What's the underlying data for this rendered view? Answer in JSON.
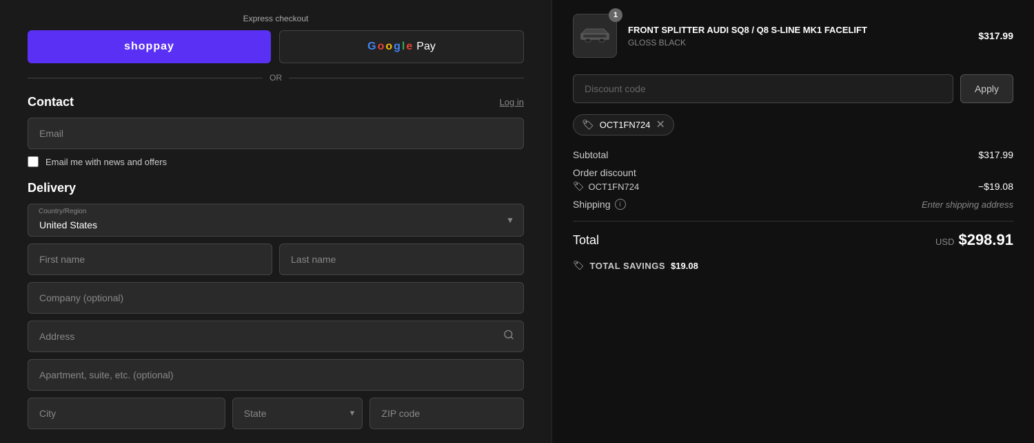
{
  "left": {
    "express_checkout_label": "Express checkout",
    "shop_pay_label": "shop pay",
    "google_pay_label": "Pay",
    "or_label": "OR",
    "contact": {
      "title": "Contact",
      "log_in_label": "Log in",
      "email_placeholder": "Email",
      "newsletter_label": "Email me with news and offers"
    },
    "delivery": {
      "title": "Delivery",
      "country_label": "Country/Region",
      "country_value": "United States",
      "first_name_placeholder": "First name",
      "last_name_placeholder": "Last name",
      "company_placeholder": "Company (optional)",
      "address_placeholder": "Address",
      "apartment_placeholder": "Apartment, suite, etc. (optional)",
      "city_placeholder": "City",
      "state_placeholder": "State",
      "zip_placeholder": "ZIP code"
    }
  },
  "right": {
    "product": {
      "name": "FRONT SPLITTER AUDI SQ8 / Q8 S-LINE MK1 FACELIFT",
      "variant": "GLOSS BLACK",
      "price": "$317.99",
      "badge": "1"
    },
    "discount": {
      "input_placeholder": "Discount code",
      "apply_label": "Apply"
    },
    "applied_code": {
      "code": "OCT1FN724",
      "remove_aria": "Remove discount code"
    },
    "summary": {
      "subtotal_label": "Subtotal",
      "subtotal_value": "$317.99",
      "order_discount_label": "Order discount",
      "discount_code": "OCT1FN724",
      "discount_value": "−$19.08",
      "shipping_label": "Shipping",
      "shipping_value": "Enter shipping address",
      "total_label": "Total",
      "total_currency": "USD",
      "total_amount": "$298.91",
      "savings_label": "TOTAL SAVINGS",
      "savings_amount": "$19.08"
    }
  }
}
